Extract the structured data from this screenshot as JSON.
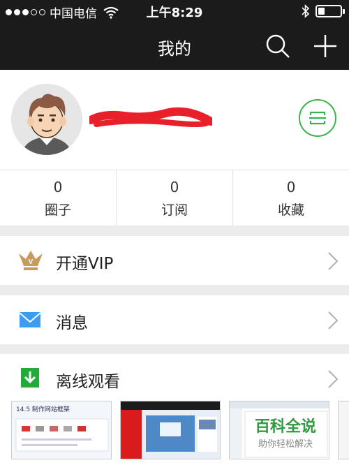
{
  "statusbar": {
    "carrier": "中国电信",
    "time": "上午8:29",
    "battery_level": 0.3
  },
  "navbar": {
    "title": "我的"
  },
  "stats": [
    {
      "count": "0",
      "label": "圈子"
    },
    {
      "count": "0",
      "label": "订阅"
    },
    {
      "count": "0",
      "label": "收藏"
    }
  ],
  "menu": {
    "vip": "开通VIP",
    "messages": "消息",
    "offline": "离线观看"
  },
  "thumbnails": {
    "first_caption": "14.5 制作网站框架",
    "baike_title": "百科全说",
    "baike_sub": "助你轻松解决"
  },
  "colors": {
    "accent": "#3cb34a",
    "navbar": "#1b1b1b",
    "message": "#3b9cf0",
    "download": "#22aa3a",
    "vip": "#c79a5e",
    "redact": "#e8202a"
  }
}
